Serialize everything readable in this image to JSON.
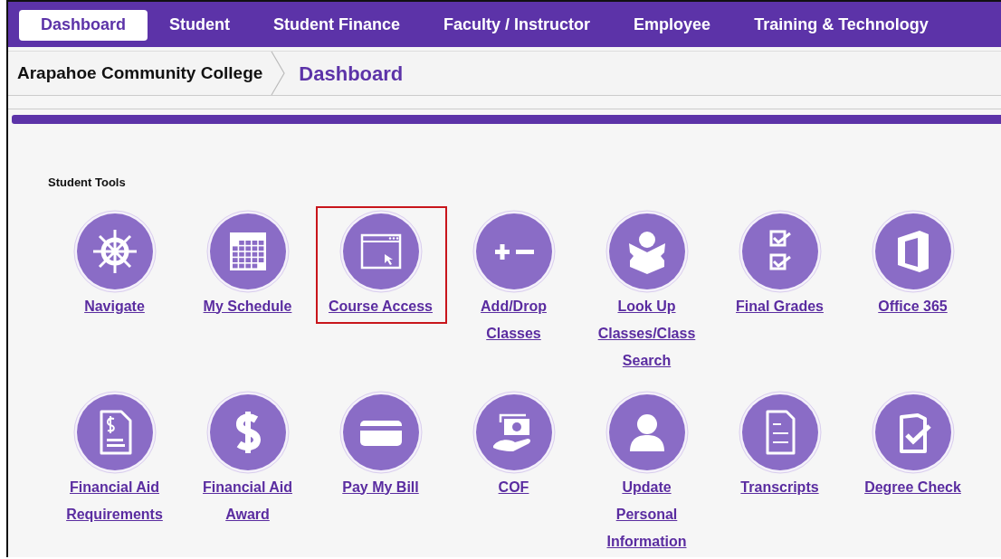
{
  "nav_tabs": [
    {
      "label": "Dashboard",
      "selected": true
    },
    {
      "label": "Student",
      "selected": false
    },
    {
      "label": "Student Finance",
      "selected": false
    },
    {
      "label": "Faculty / Instructor",
      "selected": false
    },
    {
      "label": "Employee",
      "selected": false
    },
    {
      "label": "Training & Technology",
      "selected": false
    }
  ],
  "breadcrumb": [
    "Arapahoe Community College",
    "Dashboard"
  ],
  "section_title": "Student Tools",
  "tool_rows": [
    [
      {
        "label": "Navigate",
        "highlighted": false
      },
      {
        "label": "My Schedule",
        "highlighted": false
      },
      {
        "label": "Course Access",
        "highlighted": true
      },
      {
        "label": "Add/Drop Classes",
        "highlighted": false
      },
      {
        "label": "Look Up Classes/Class Search",
        "highlighted": false
      },
      {
        "label": "Final Grades",
        "highlighted": false
      },
      {
        "label": "Office 365",
        "highlighted": false
      }
    ],
    [
      {
        "label": "Financial Aid Requirements",
        "highlighted": false
      },
      {
        "label": "Financial Aid Award",
        "highlighted": false
      },
      {
        "label": "Pay My Bill",
        "highlighted": false
      },
      {
        "label": "COF",
        "highlighted": false
      },
      {
        "label": "Update Personal Information",
        "highlighted": false
      },
      {
        "label": "Transcripts",
        "highlighted": false
      },
      {
        "label": "Degree Check",
        "highlighted": false
      }
    ]
  ]
}
